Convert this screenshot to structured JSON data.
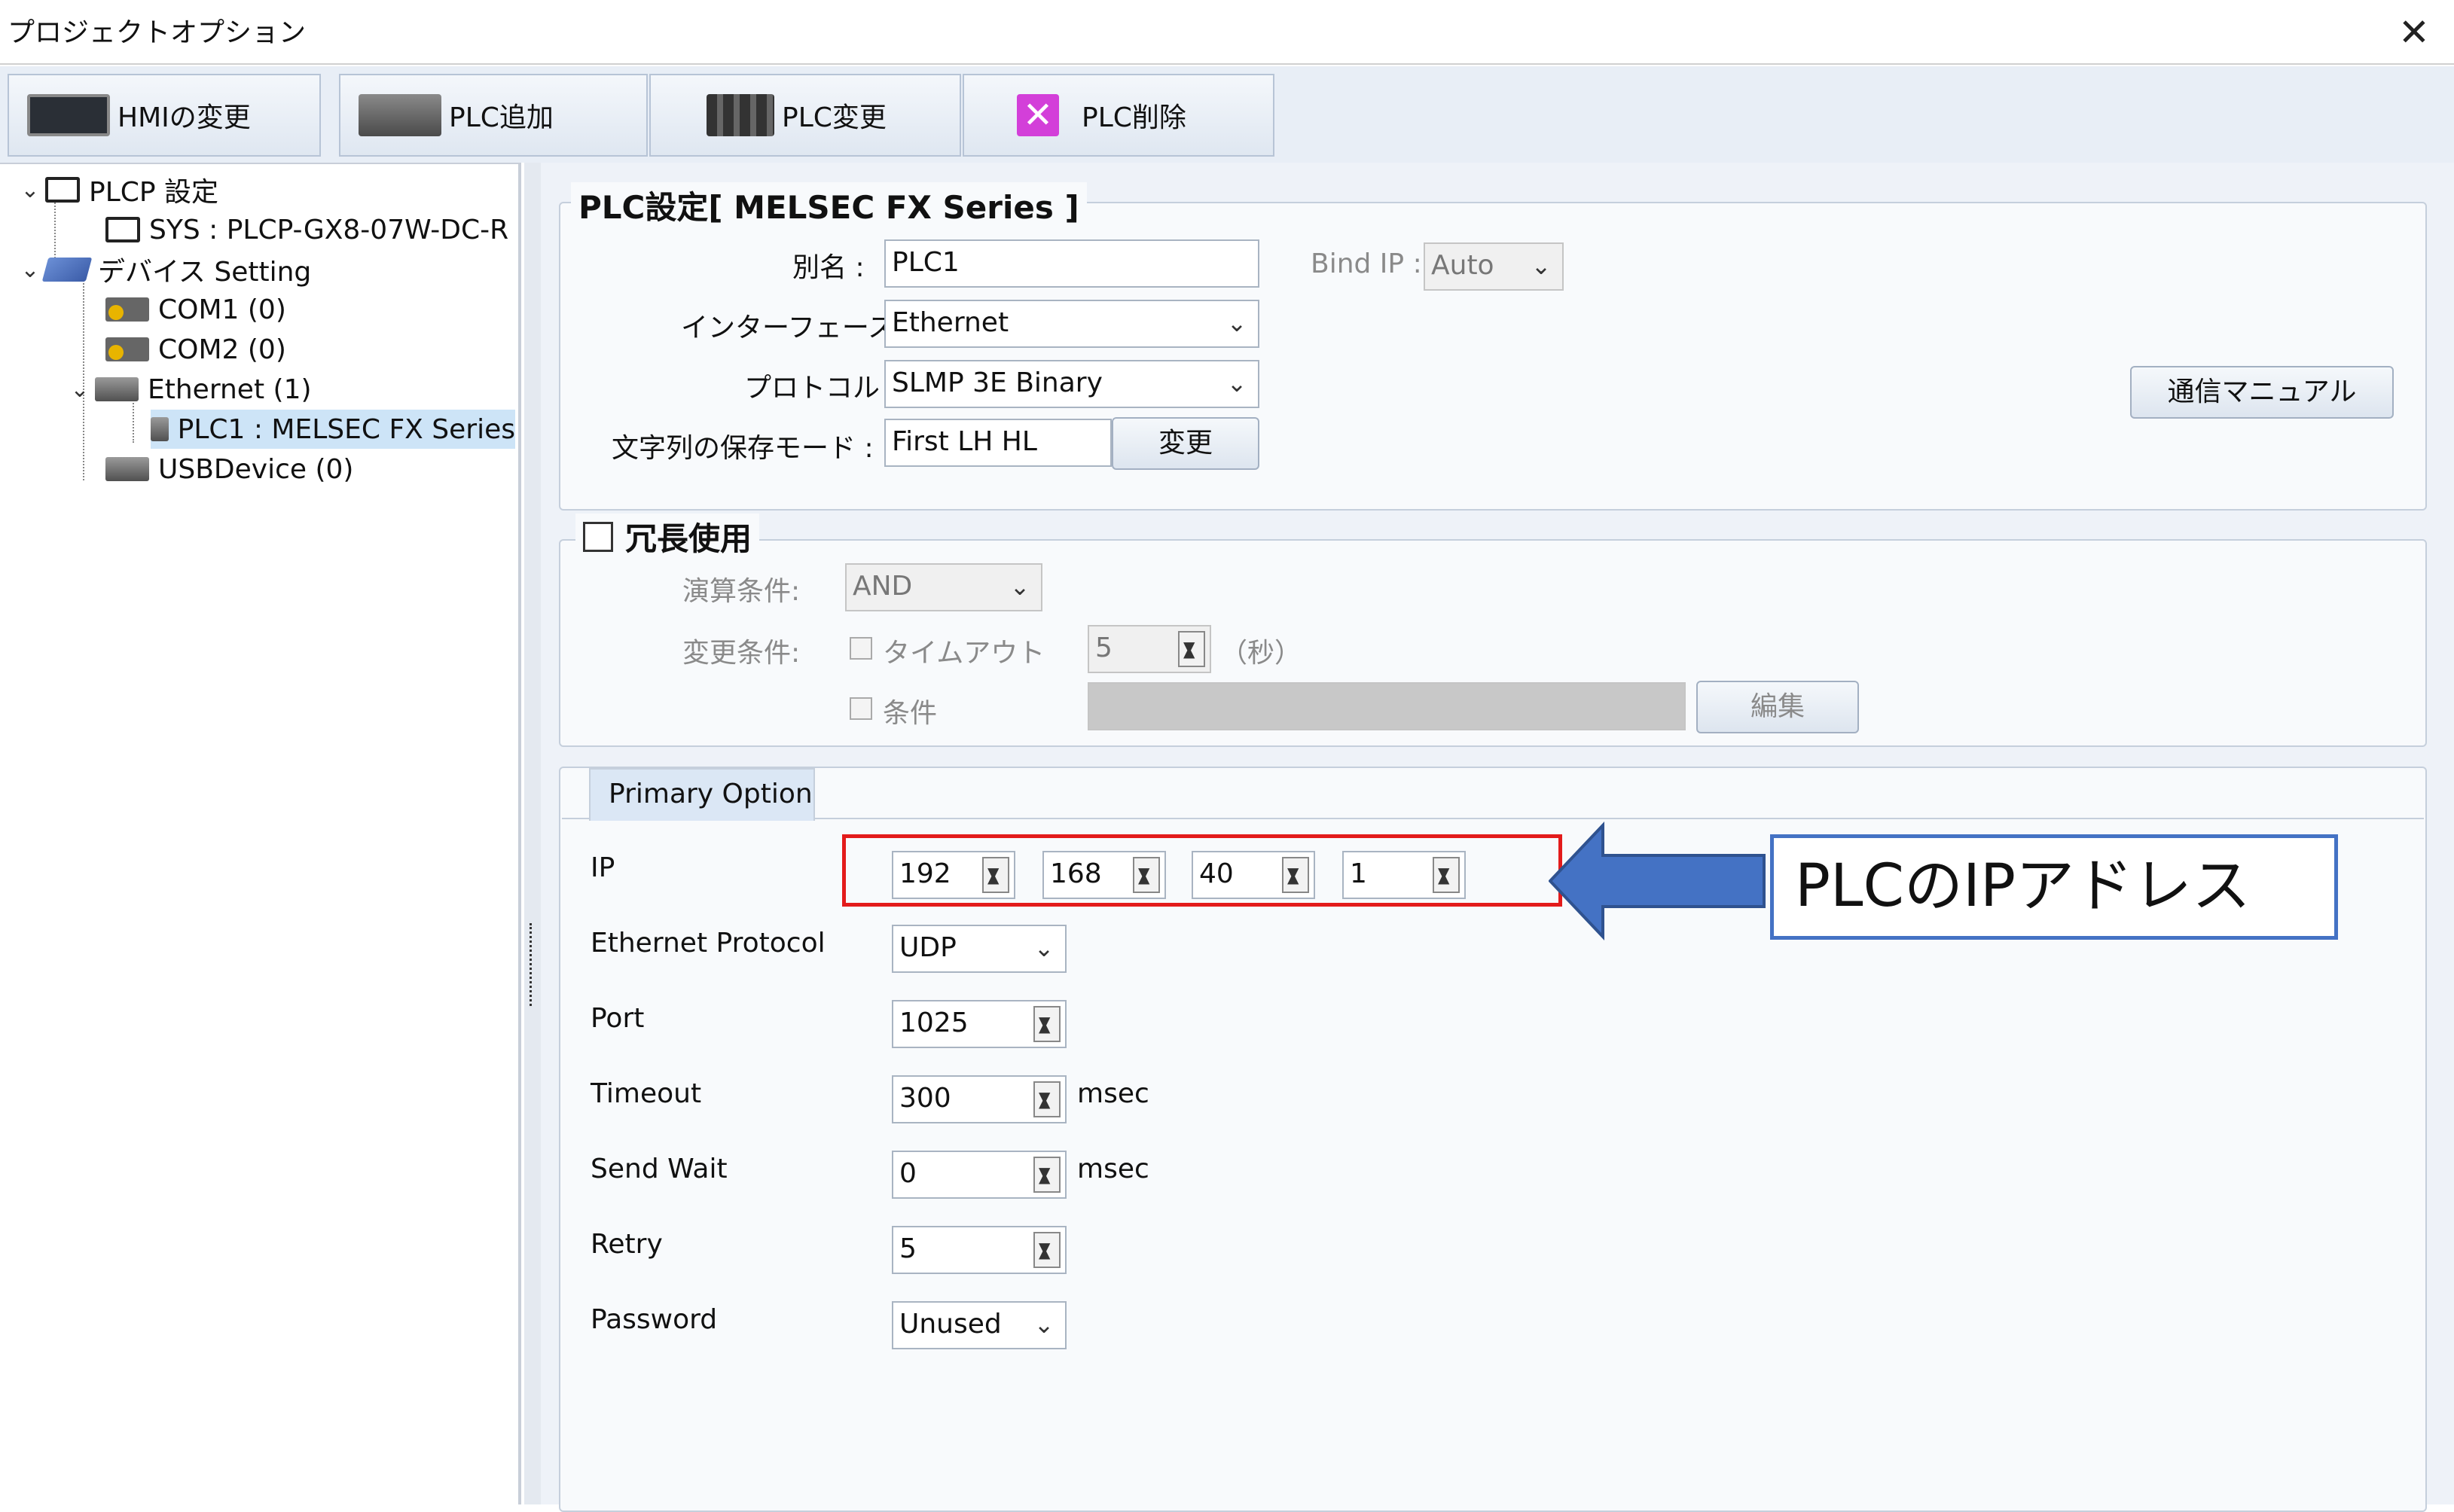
{
  "window": {
    "title": "プロジェクトオプション",
    "close_glyph": "✕"
  },
  "toolbar": {
    "hmi_change": "HMIの変更",
    "plc_add": "PLC追加",
    "plc_change": "PLC変更",
    "plc_delete": "PLC削除"
  },
  "tree": {
    "plcp_settings": "PLCP 設定",
    "sys": "SYS : PLCP-GX8-07W-DC-R",
    "device_setting": "デバイス Setting",
    "com1": "COM1 (0)",
    "com2": "COM2 (0)",
    "ethernet": "Ethernet (1)",
    "plc1": "PLC1 : MELSEC FX Series",
    "usb": "USBDevice (0)"
  },
  "plc_settings": {
    "group_title": "PLC設定[ MELSEC FX Series ]",
    "alias_label": "別名 :",
    "alias_value": "PLC1",
    "bind_ip_label": "Bind IP :",
    "bind_ip_value": "Auto",
    "interface_label": "インターフェース :",
    "interface_value": "Ethernet",
    "protocol_label": "プロトコル :",
    "protocol_value": "SLMP 3E Binary",
    "string_mode_label": "文字列の保存モード :",
    "string_mode_value": "First LH HL",
    "change_button": "変更",
    "manual_button": "通信マニュアル"
  },
  "redundancy": {
    "title": "冗長使用",
    "calc_label": "演算条件:",
    "calc_value": "AND",
    "change_cond_label": "変更条件:",
    "timeout_label": "タイムアウト",
    "timeout_value": "5",
    "seconds_label": "（秒）",
    "condition_label": "条件",
    "edit_button": "編集"
  },
  "primary_option": {
    "tab_label": "Primary Option",
    "ip_label": "IP",
    "ip": [
      "192",
      "168",
      "40",
      "1"
    ],
    "eth_protocol_label": "Ethernet Protocol",
    "eth_protocol_value": "UDP",
    "port_label": "Port",
    "port_value": "1025",
    "timeout_label": "Timeout",
    "timeout_value": "300",
    "timeout_unit": "msec",
    "send_wait_label": "Send Wait",
    "send_wait_value": "0",
    "send_wait_unit": "msec",
    "retry_label": "Retry",
    "retry_value": "5",
    "password_label": "Password",
    "password_value": "Unused"
  },
  "annotation": {
    "callout_text": "PLCのIPアドレス",
    "highlight_color": "#e31b1b",
    "arrow_color": "#4472c4"
  }
}
